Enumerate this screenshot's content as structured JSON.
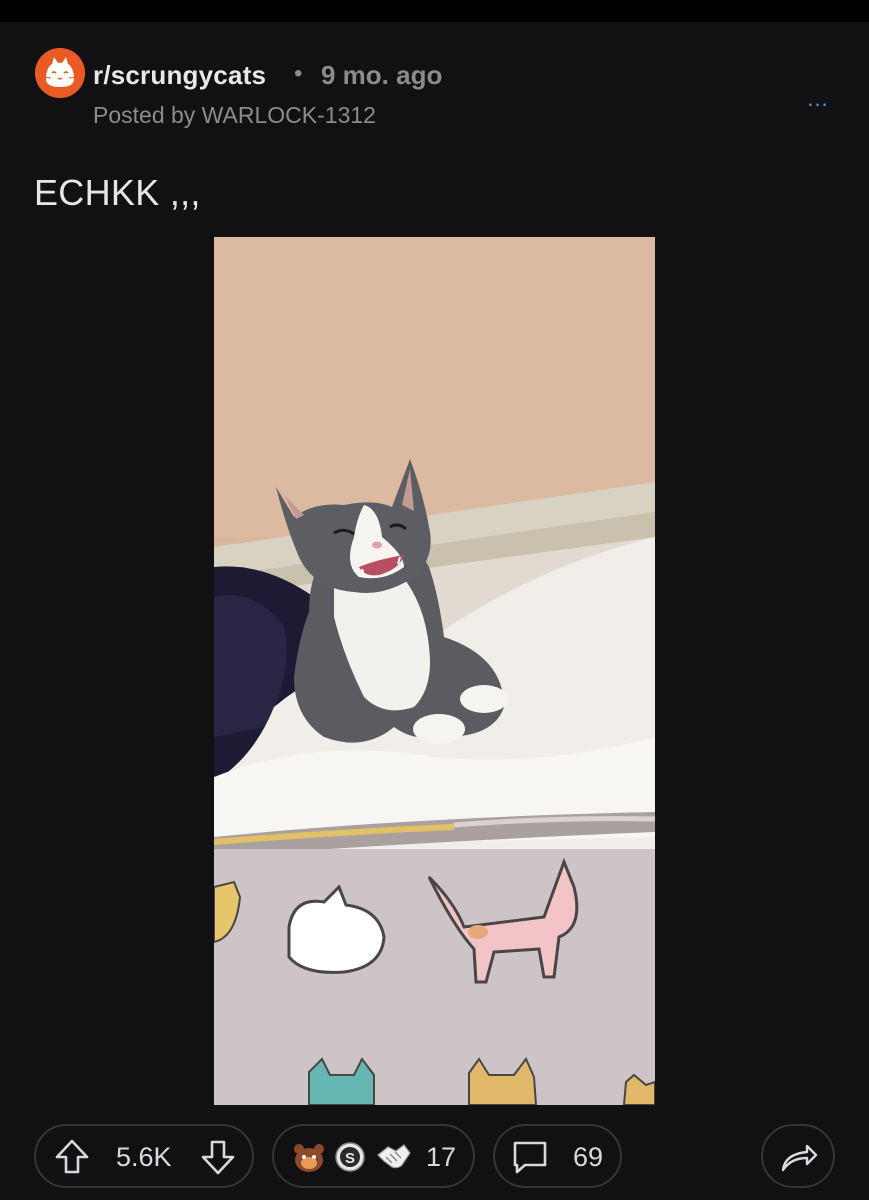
{
  "post": {
    "subreddit": "r/scrungycats",
    "separator": "•",
    "age": "9 mo. ago",
    "posted_by": "Posted by WARLOCK-1312",
    "more_label": "...",
    "title": "ECHKK ,,,"
  },
  "actions": {
    "upvotes": "5.6K",
    "awards_count": "17",
    "comments": "69"
  },
  "icons": {
    "avatar": "subreddit-cat-icon",
    "upvote": "arrow-up-icon",
    "downvote": "arrow-down-icon",
    "award_1": "bear-award-icon",
    "award_2": "silver-award-icon",
    "award_3": "handshake-award-icon",
    "comment": "speech-bubble-icon",
    "share": "share-arrow-icon"
  },
  "colors": {
    "background": "#111113",
    "avatar": "#ea5a24",
    "more_dots": "#4c9ee5",
    "muted_text": "#8a8c8e"
  }
}
